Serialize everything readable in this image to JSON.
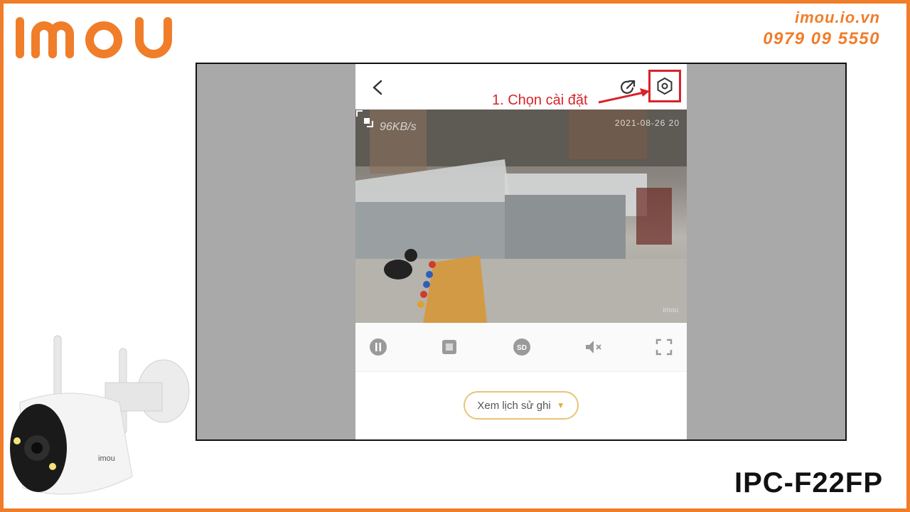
{
  "brand": {
    "logo_text": "imou",
    "website": "imou.io.vn",
    "phone": "0979 09 5550",
    "accent_color": "#f07d2a",
    "model": "IPC-F22FP"
  },
  "app": {
    "annotation": "1. Chọn cài đặt",
    "annotation_color": "#d8232a",
    "icons": {
      "back": "back-arrow-icon",
      "share": "share-icon",
      "settings": "settings-icon",
      "expand": "expand-icon"
    },
    "video": {
      "bitrate": "96KB/s",
      "timestamp": "2021-08-26 20",
      "watermark": "imou"
    },
    "controls": [
      {
        "icon": "pause-icon"
      },
      {
        "icon": "screenshot-icon"
      },
      {
        "icon": "sd-quality-icon",
        "label": "SD"
      },
      {
        "icon": "mute-icon"
      },
      {
        "icon": "fullscreen-icon"
      }
    ],
    "history_button": "Xem lịch sử ghi"
  }
}
